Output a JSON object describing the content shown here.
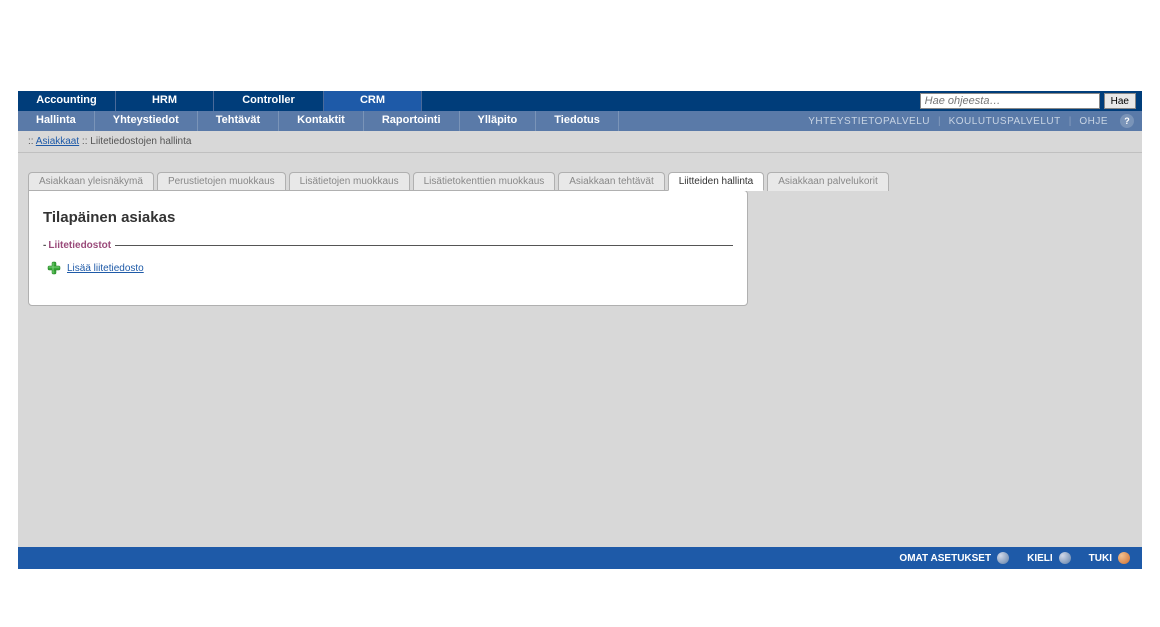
{
  "top_nav": {
    "items": [
      {
        "label": "Accounting"
      },
      {
        "label": "HRM"
      },
      {
        "label": "Controller"
      },
      {
        "label": "CRM"
      }
    ],
    "active_index": 3,
    "search_placeholder": "Hae ohjeesta…",
    "search_button": "Hae"
  },
  "sub_nav": {
    "items": [
      {
        "label": "Hallinta"
      },
      {
        "label": "Yhteystiedot"
      },
      {
        "label": "Tehtävät"
      },
      {
        "label": "Kontaktit"
      },
      {
        "label": "Raportointi"
      },
      {
        "label": "Ylläpito"
      },
      {
        "label": "Tiedotus"
      }
    ],
    "right_links": {
      "yhteystietopalvelu": "YHTEYSTIETOPALVELU",
      "koulutuspalvelut": "KOULUTUSPALVELUT",
      "ohje": "OHJE"
    }
  },
  "breadcrumb": {
    "prefix": ":: ",
    "link": "Asiakkaat",
    "separator": "  ::  ",
    "current": "Liitetiedostojen hallinta"
  },
  "tabs": [
    {
      "label": "Asiakkaan yleisnäkymä"
    },
    {
      "label": "Perustietojen muokkaus"
    },
    {
      "label": "Lisätietojen muokkaus"
    },
    {
      "label": "Lisätietokenttien muokkaus"
    },
    {
      "label": "Asiakkaan tehtävät"
    },
    {
      "label": "Liitteiden hallinta"
    },
    {
      "label": "Asiakkaan palvelukorit"
    }
  ],
  "active_tab_index": 5,
  "panel": {
    "title": "Tilapäinen asiakas",
    "section_label": "Liitetiedostot",
    "add_link": "Lisää liitetiedosto"
  },
  "footer": {
    "omat_asetukset": "OMAT ASETUKSET",
    "kieli": "KIELI",
    "tuki": "TUKI"
  }
}
